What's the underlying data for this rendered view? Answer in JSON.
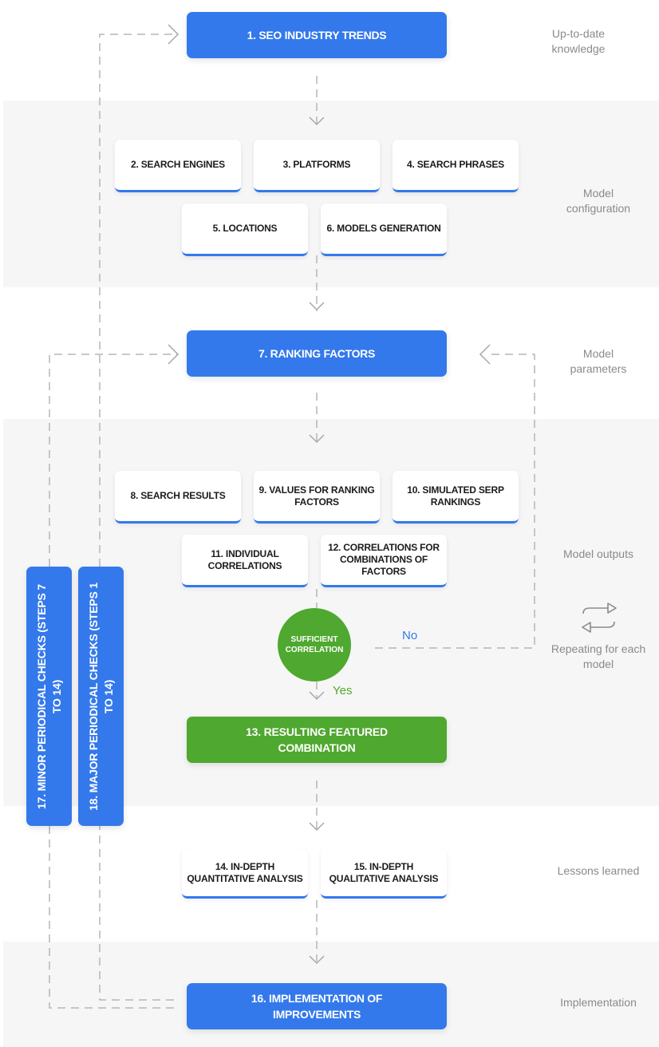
{
  "colors": {
    "primary_blue": "#3479eb",
    "decision_green": "#4fa82f",
    "band_gray": "#f6f6f6",
    "side_label_gray": "#8a8a8a",
    "connector_gray": "#b5b5b5"
  },
  "steps": {
    "s1": "1. SEO Industry Trends",
    "s2": "2. Search Engines",
    "s3": "3. Platforms",
    "s4": "4. Search Phrases",
    "s5": "5. Locations",
    "s6": "6. Models Generation",
    "s7": "7. Ranking Factors",
    "s8": "8. Search Results",
    "s9": "9. Values for Ranking Factors",
    "s10": "10. Simulated SERP Rankings",
    "s11": "11. Individual Correlations",
    "s12": "12. Correlations for Combinations of Factors",
    "s13": "13. Resulting Featured Combination",
    "s14": "14. In-depth Quantitative Analysis",
    "s15": "15. In-depth Qualitative Analysis",
    "s16": "16. Implementation of Improvements",
    "s17": "17. Minor Periodical Checks (Steps 7 to 14)",
    "s18": "18. Major Periodical Checks (Steps 1 to 14)"
  },
  "decision": {
    "label": "Sufficient Correlation",
    "yes_label": "Yes",
    "no_label": "No"
  },
  "side_labels": {
    "knowledge": "Up-to-date knowledge",
    "configuration": "Model configuration",
    "parameters": "Model parameters",
    "outputs": "Model outputs",
    "repeating": "Repeating for each model",
    "lessons": "Lessons learned",
    "implementation": "Implementation"
  },
  "icons": {
    "repeat": "repeat-arrows-icon"
  }
}
